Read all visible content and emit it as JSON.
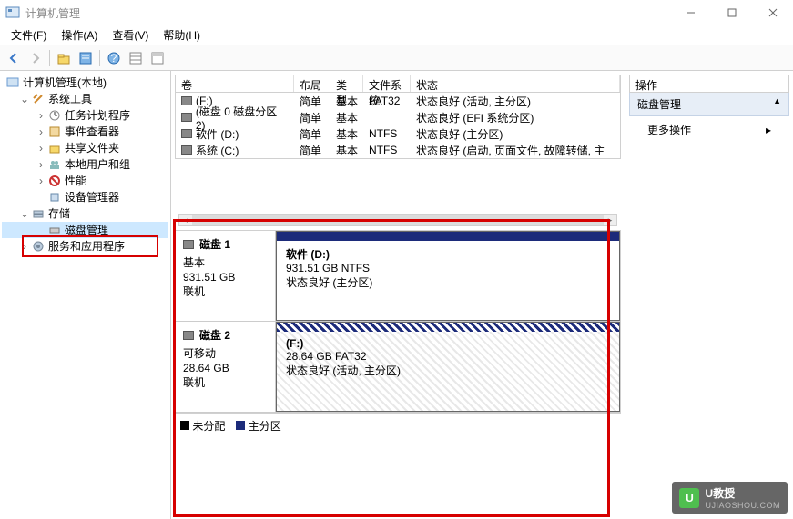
{
  "window": {
    "title": "计算机管理"
  },
  "menu": {
    "file": "文件(F)",
    "action": "操作(A)",
    "view": "查看(V)",
    "help": "帮助(H)"
  },
  "tree": {
    "root": "计算机管理(本地)",
    "systools": "系统工具",
    "scheduler": "任务计划程序",
    "eventvwr": "事件查看器",
    "shared": "共享文件夹",
    "users": "本地用户和组",
    "perf": "性能",
    "devmgr": "设备管理器",
    "storage": "存储",
    "diskmgmt": "磁盘管理",
    "services": "服务和应用程序"
  },
  "volcols": {
    "vol": "卷",
    "layout": "布局",
    "type": "类型",
    "fs": "文件系统",
    "status": "状态"
  },
  "volumes": [
    {
      "name": "(F:)",
      "layout": "简单",
      "type": "基本",
      "fs": "FAT32",
      "status": "状态良好 (活动, 主分区)"
    },
    {
      "name": "(磁盘 0 磁盘分区 2)",
      "layout": "简单",
      "type": "基本",
      "fs": "",
      "status": "状态良好 (EFI 系统分区)"
    },
    {
      "name": "软件 (D:)",
      "layout": "简单",
      "type": "基本",
      "fs": "NTFS",
      "status": "状态良好 (主分区)"
    },
    {
      "name": "系统 (C:)",
      "layout": "简单",
      "type": "基本",
      "fs": "NTFS",
      "status": "状态良好 (启动, 页面文件, 故障转储, 主"
    }
  ],
  "disks": [
    {
      "label": "磁盘 1",
      "type": "基本",
      "size": "931.51 GB",
      "state": "联机",
      "part": {
        "name": "软件  (D:)",
        "info": "931.51 GB NTFS",
        "status": "状态良好 (主分区)",
        "hatched": false
      }
    },
    {
      "label": "磁盘 2",
      "type": "可移动",
      "size": "28.64 GB",
      "state": "联机",
      "part": {
        "name": "(F:)",
        "info": "28.64 GB FAT32",
        "status": "状态良好 (活动, 主分区)",
        "hatched": true
      }
    }
  ],
  "legend": {
    "unalloc": "未分配",
    "primary": "主分区"
  },
  "actions": {
    "title": "操作",
    "section": "磁盘管理",
    "more": "更多操作"
  },
  "watermark": {
    "brand": "U教授",
    "sub": "UJIAOSHOU.COM"
  }
}
